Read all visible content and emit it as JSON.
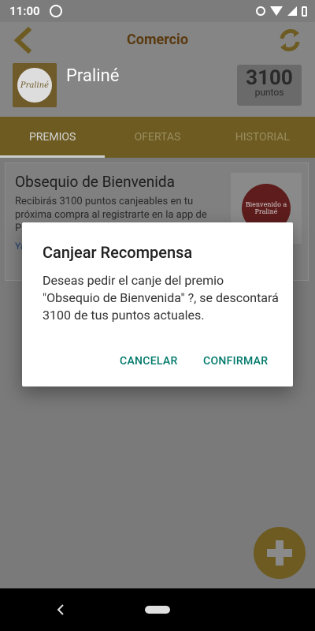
{
  "status_bar": {
    "time": "11:00",
    "icons": [
      "at-icon",
      "alarm-icon",
      "wifi-icon",
      "signal-icon",
      "battery-icon"
    ]
  },
  "app_bar": {
    "title": "Comercio",
    "back_icon": "back-arrow-icon",
    "refresh_icon": "refresh-icon"
  },
  "merchant": {
    "name": "Praliné",
    "logo_text": "Praliné",
    "points_value": "3100",
    "points_label": "puntos"
  },
  "tabs": [
    {
      "label": "PREMIOS",
      "active": true
    },
    {
      "label": "OFERTAS",
      "active": false
    },
    {
      "label": "HISTORIAL",
      "active": false
    }
  ],
  "reward_card": {
    "title": "Obsequio de Bienvenida",
    "description": "Recibirás 3100 puntos canjeables en tu próxima compra al registrarte en la app de Praliné",
    "link_text": "Ya",
    "image_text": "Bienvenido a Praliné"
  },
  "dialog": {
    "title": "Canjear Recompensa",
    "message": "Deseas pedir el canje del premio \"Obsequio de Bienvenida\" ?, se descontará 3100 de tus puntos actuales.",
    "cancel_label": "CANCELAR",
    "confirm_label": "CONFIRMAR"
  },
  "colors": {
    "accent": "#00796b",
    "brand_gold": "#d4b24a",
    "brand_brown": "#6a4310"
  }
}
